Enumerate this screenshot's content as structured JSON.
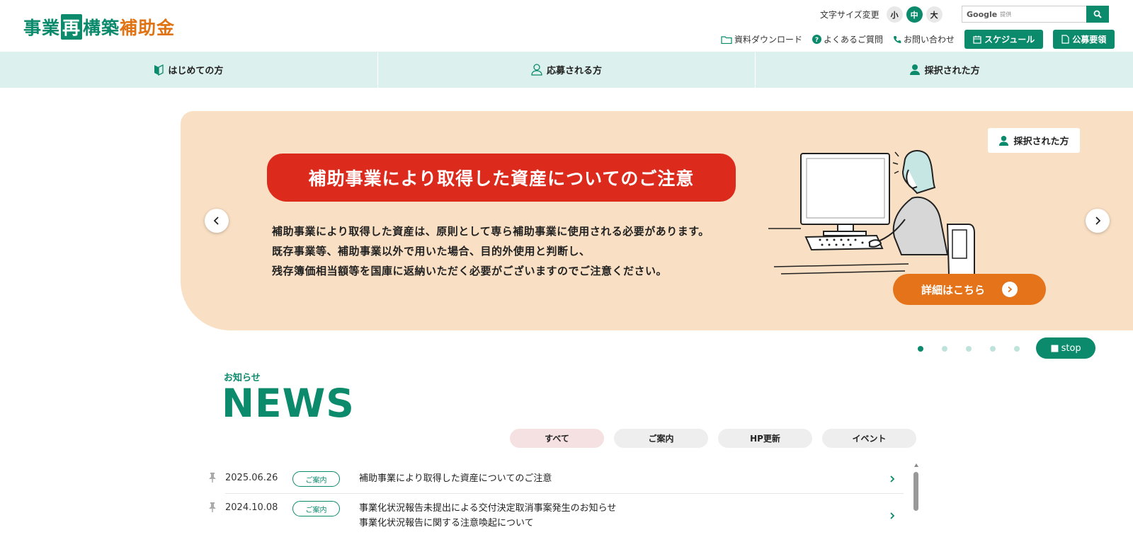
{
  "header": {
    "logo": {
      "part1": "事業",
      "part2": "再",
      "part3": "構築",
      "part4": "補助金"
    },
    "font_size": {
      "label": "文字サイズ変更",
      "small": "小",
      "medium": "中",
      "large": "大",
      "selected": "中"
    },
    "search": {
      "brand": "Google",
      "provided": "提供"
    },
    "links": [
      {
        "label": "資料ダウンロード",
        "icon": "folder-icon"
      },
      {
        "label": "よくあるご質問",
        "icon": "question-icon"
      },
      {
        "label": "お問い合わせ",
        "icon": "phone-icon"
      }
    ],
    "schedule_label": "スケジュール",
    "guidelines_label": "公募要領"
  },
  "nav": [
    {
      "label": "はじめての方",
      "icon": "beginner-mark-icon"
    },
    {
      "label": "応募される方",
      "icon": "person-outline-icon"
    },
    {
      "label": "採択された方",
      "icon": "person-filled-icon"
    }
  ],
  "hero": {
    "title": "補助事業により取得した資産についてのご注意",
    "body": [
      "補助事業により取得した資産は、原則として専ら補助事業に使用される必要があります。",
      "既存事業等、補助事業以外で用いた場合、目的外使用と判断し、",
      "残存簿価相当額等を国庫に返納いただく必要がございますのでご注意ください。"
    ],
    "tag": "採択された方",
    "cta": "詳細はこちら",
    "slides_total": 5,
    "active_slide": 1,
    "stop_label": "stop"
  },
  "news": {
    "subtitle": "お知らせ",
    "title": "NEWS",
    "tabs": [
      "すべて",
      "ご案内",
      "HP更新",
      "イベント"
    ],
    "active_tab": "すべて",
    "items": [
      {
        "date": "2025.06.26",
        "category": "ご案内",
        "lines": [
          "補助事業により取得した資産についてのご注意"
        ]
      },
      {
        "date": "2024.10.08",
        "category": "ご案内",
        "lines": [
          "事業化状況報告未提出による交付決定取消事案発生のお知らせ",
          "事業化状況報告に関する注意喚起について"
        ]
      }
    ]
  },
  "colors": {
    "brand_green": "#0b8a6c",
    "brand_orange": "#e07314",
    "alert_red": "#dc2a1d",
    "hero_bg": "#f9dfc3",
    "nav_bg": "#dcf1ed"
  }
}
